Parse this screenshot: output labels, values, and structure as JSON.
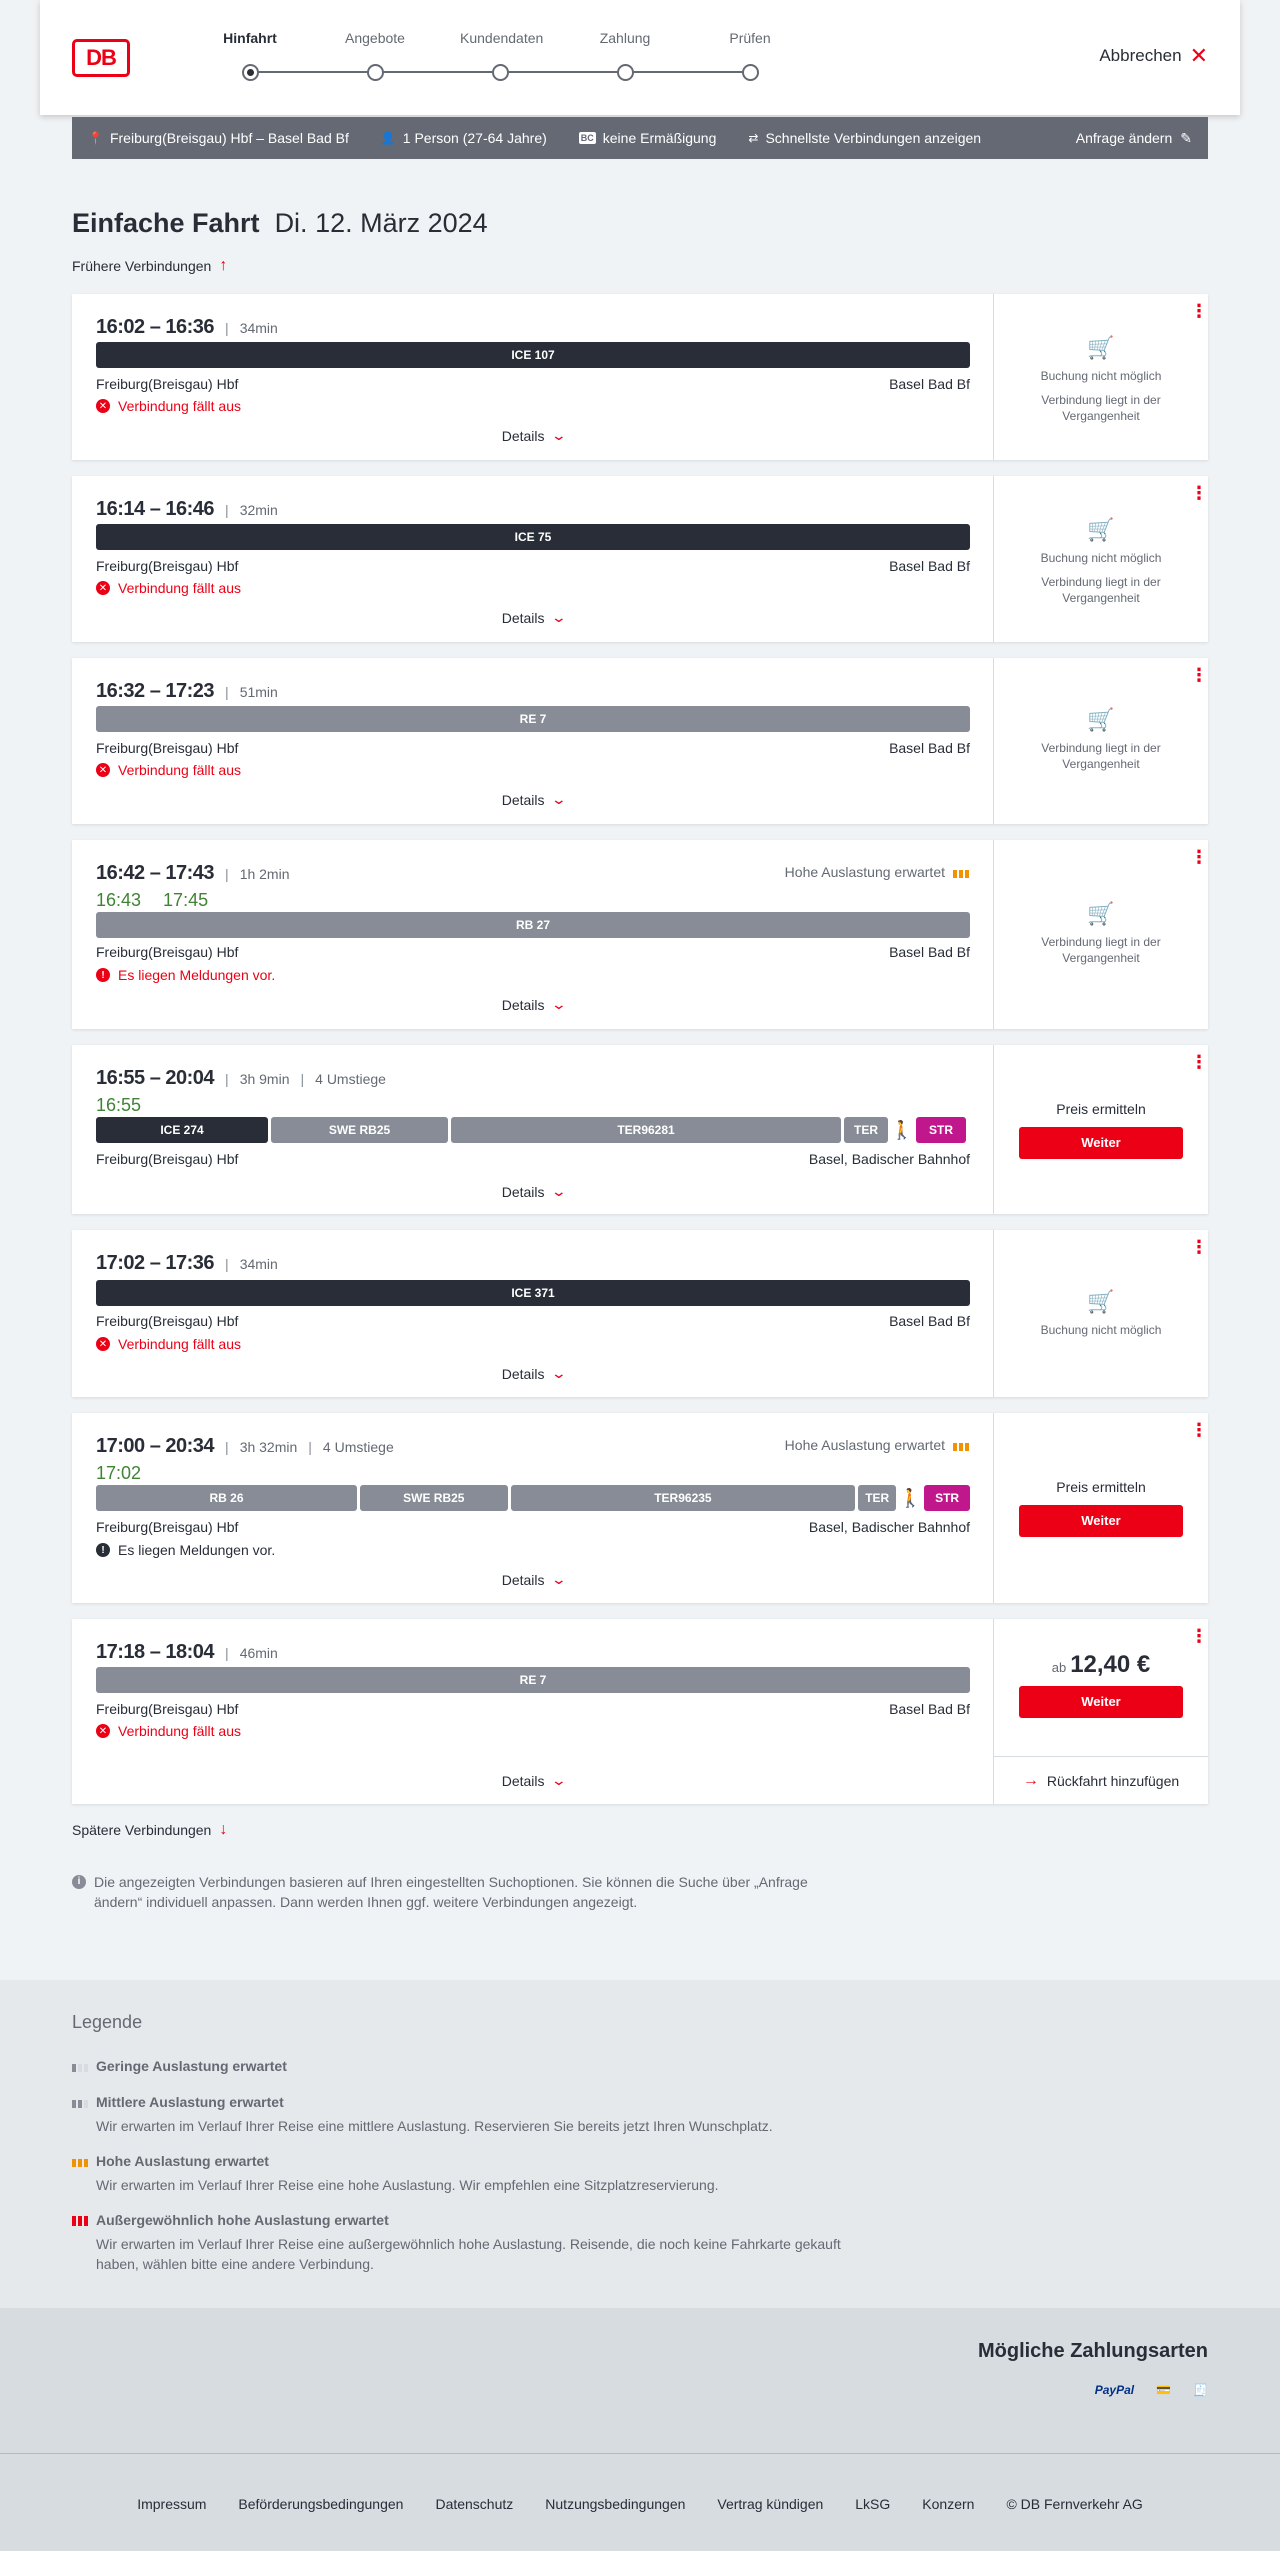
{
  "header": {
    "logo": "DB",
    "steps": [
      "Hinfahrt",
      "Angebote",
      "Kundendaten",
      "Zahlung",
      "Prüfen"
    ],
    "cancel_label": "Abbrechen"
  },
  "searchbar": {
    "route": "Freiburg(Breisgau) Hbf – Basel Bad Bf",
    "passengers": "1 Person (27-64 Jahre)",
    "discount_badge": "BC",
    "discount": "keine Ermäßigung",
    "option": "Schnellste Verbindungen anzeigen",
    "change": "Anfrage ändern"
  },
  "title": {
    "type": "Einfache Fahrt",
    "date": "Di. 12. März 2024"
  },
  "earlier": "Frühere Verbindungen",
  "later": "Spätere Verbindungen",
  "connections": [
    {
      "times": "16:02 – 16:36",
      "duration": "34min",
      "segments": [
        "ICE 107"
      ],
      "from": "Freiburg(Breisgau) Hbf",
      "to": "Basel Bad Bf",
      "notice": "Verbindung fällt aus",
      "details": "Details",
      "side1": "Buchung nicht möglich",
      "side2": "Verbindung liegt in der Vergangenheit"
    },
    {
      "times": "16:14 – 16:46",
      "duration": "32min",
      "segments": [
        "ICE 75"
      ],
      "from": "Freiburg(Breisgau) Hbf",
      "to": "Basel Bad Bf",
      "notice": "Verbindung fällt aus",
      "details": "Details",
      "side1": "Buchung nicht möglich",
      "side2": "Verbindung liegt in der Vergangenheit"
    },
    {
      "times": "16:32 – 17:23",
      "duration": "51min",
      "segments": [
        "RE 7"
      ],
      "from": "Freiburg(Breisgau) Hbf",
      "to": "Basel Bad Bf",
      "notice": "Verbindung fällt aus",
      "details": "Details",
      "side2": "Verbindung liegt in der Vergangenheit"
    },
    {
      "times": "16:42 – 17:43",
      "duration": "1h 2min",
      "occupancy": "Hohe Auslastung erwartet",
      "rt_dep": "16:43",
      "rt_arr": "17:45",
      "segments": [
        "RB 27"
      ],
      "from": "Freiburg(Breisgau) Hbf",
      "to": "Basel Bad Bf",
      "notice": "Es liegen Meldungen vor.",
      "details": "Details",
      "side2": "Verbindung liegt in der Vergangenheit"
    },
    {
      "times": "16:55 – 20:04",
      "duration": "3h 9min",
      "changes": "4 Umstiege",
      "rt_dep": "16:55",
      "segments": [
        "ICE 274",
        "SWE RB25",
        "TER96281",
        "TER",
        "STR"
      ],
      "from": "Freiburg(Breisgau) Hbf",
      "to": "Basel, Badischer Bahnhof",
      "details": "Details",
      "price_label": "Preis ermitteln",
      "button": "Weiter"
    },
    {
      "times": "17:02 – 17:36",
      "duration": "34min",
      "segments": [
        "ICE 371"
      ],
      "from": "Freiburg(Breisgau) Hbf",
      "to": "Basel Bad Bf",
      "notice": "Verbindung fällt aus",
      "details": "Details",
      "side1": "Buchung nicht möglich"
    },
    {
      "times": "17:00 – 20:34",
      "duration": "3h 32min",
      "changes": "4 Umstiege",
      "occupancy": "Hohe Auslastung erwartet",
      "rt_dep": "17:02",
      "segments": [
        "RB 26",
        "SWE RB25",
        "TER96235",
        "TER",
        "STR"
      ],
      "from": "Freiburg(Breisgau) Hbf",
      "to": "Basel, Badischer Bahnhof",
      "notice": "Es liegen Meldungen vor.",
      "details": "Details",
      "price_label": "Preis ermitteln",
      "button": "Weiter"
    },
    {
      "times": "17:18 – 18:04",
      "duration": "46min",
      "segments": [
        "RE 7"
      ],
      "from": "Freiburg(Breisgau) Hbf",
      "to": "Basel Bad Bf",
      "notice": "Verbindung fällt aus",
      "details": "Details",
      "price_prefix": "ab",
      "price": "12,40 €",
      "button": "Weiter",
      "return": "Rückfahrt hinzufügen"
    }
  ],
  "info_note": "Die angezeigten Verbindungen basieren auf Ihren eingestellten Suchoptionen. Sie können die Suche über „Anfrage ändern“ individuell anpassen. Dann werden Ihnen ggf. weitere Verbindungen angezeigt.",
  "legend": {
    "title": "Legende",
    "items": [
      {
        "title": "Geringe Auslastung erwartet",
        "desc": ""
      },
      {
        "title": "Mittlere Auslastung erwartet",
        "desc": "Wir erwarten im Verlauf Ihrer Reise eine mittlere Auslastung. Reservieren Sie bereits jetzt Ihren Wunschplatz."
      },
      {
        "title": "Hohe Auslastung erwartet",
        "desc": "Wir erwarten im Verlauf Ihrer Reise eine hohe Auslastung. Wir empfehlen eine Sitzplatzreservierung."
      },
      {
        "title": "Außergewöhnlich hohe Auslastung erwartet",
        "desc": "Wir erwarten im Verlauf Ihrer Reise eine außergewöhnlich hohe Auslastung. Reisende, die noch keine Fahrkarte gekauft haben, wählen bitte eine andere Verbindung."
      }
    ]
  },
  "payment": {
    "title": "Mögliche Zahlungsarten",
    "paypal": "PayPal"
  },
  "footer": [
    "Impressum",
    "Beförderungsbedingungen",
    "Datenschutz",
    "Nutzungsbedingungen",
    "Vertrag kündigen",
    "LkSG",
    "Konzern",
    "© DB Fernverkehr AG"
  ],
  "colors": {
    "accent": "#ec0016",
    "dark": "#282d37",
    "delay_ok": "#408335",
    "occupancy_high": "#f39200"
  }
}
